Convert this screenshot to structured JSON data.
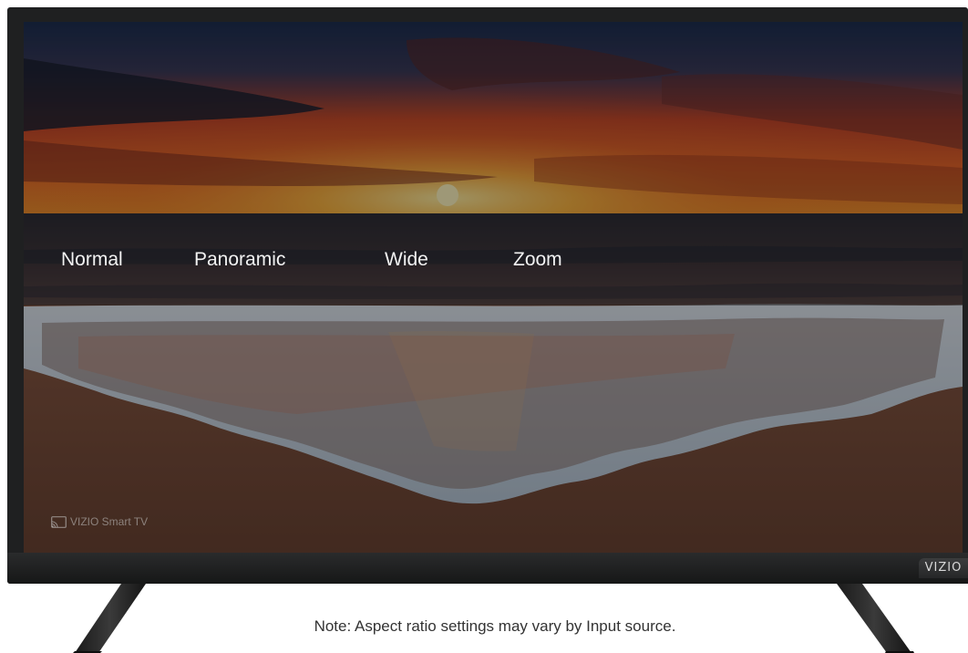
{
  "menu": {
    "items": [
      {
        "label": "Normal"
      },
      {
        "label": "Panoramic"
      },
      {
        "label": "Wide"
      },
      {
        "label": "Zoom"
      }
    ]
  },
  "screen": {
    "watermark_text": "VIZIO Smart TV",
    "watermark_icon": "cast-icon"
  },
  "tv": {
    "brand_badge": "VIZIO"
  },
  "footer": {
    "note": "Note: Aspect ratio settings may vary by Input source."
  },
  "colors": {
    "bezel": "#1f2021",
    "menu_text": "#f2f2f2",
    "note_text": "#333333"
  }
}
